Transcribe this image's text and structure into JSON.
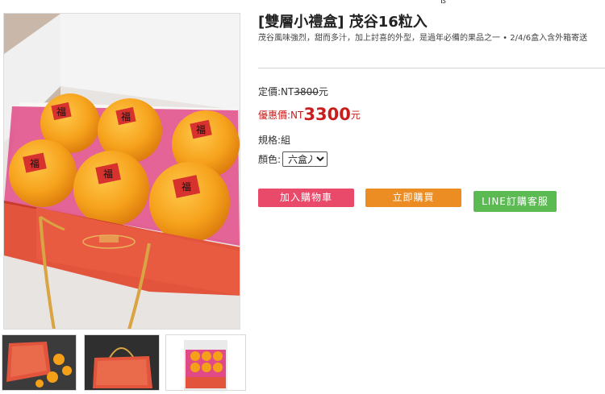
{
  "product": {
    "top_stub": "ß",
    "title": "[雙層小禮盒] 茂谷16粒入",
    "description": "茂谷風味強烈，甜而多汁，加上討喜的外型，是過年必備的果品之一 • 2/4/6盒入含外箱寄送",
    "list_price_label": "定價:NT",
    "list_price_value": "3800",
    "list_price_unit": "元",
    "sale_price_label": "優惠價:NT",
    "sale_price_value": "3300",
    "sale_price_unit": "元",
    "spec_label": "規格:組",
    "color_label": "顏色:",
    "color_selected": "六盒入",
    "fruit_label": "福"
  },
  "buttons": {
    "add_to_cart": "加入購物車",
    "buy_now": "立即購買",
    "line_service": "LINE訂購客服"
  },
  "colors": {
    "sale_red": "#c81e1e",
    "cart_pink": "#ea4a6a",
    "buy_orange": "#ec8d24",
    "line_green": "#5cba52",
    "box_red": "#e2553c",
    "orange_fruit": "#f5a019"
  }
}
